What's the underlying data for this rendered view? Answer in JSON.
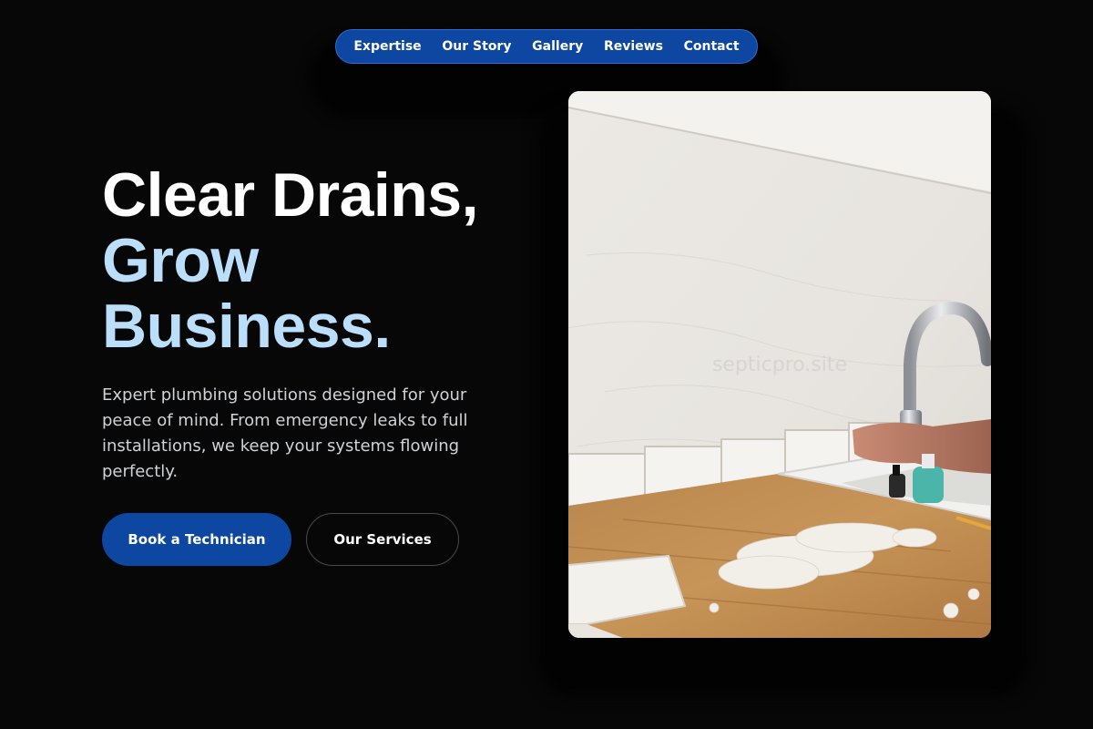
{
  "nav": {
    "items": [
      {
        "label": "Expertise"
      },
      {
        "label": "Our Story"
      },
      {
        "label": "Gallery"
      },
      {
        "label": "Reviews"
      },
      {
        "label": "Contact"
      }
    ]
  },
  "hero": {
    "title_line1": "Clear Drains,",
    "title_line2": "Grow",
    "title_line3": "Business.",
    "description": "Expert plumbing solutions designed for your peace of mind. From emergency leaks to full installations, we keep your systems flowing perfectly.",
    "primary_button": "Book a Technician",
    "secondary_button": "Our Services"
  },
  "image": {
    "subject": "kitchen-sink-faucet-with-tile-spacers-photo",
    "watermark": "septicpro.site"
  },
  "colors": {
    "background": "#070707",
    "brand_blue": "#0d47a1",
    "accent_light_blue": "#bbdefb",
    "text_white": "#ffffff"
  }
}
